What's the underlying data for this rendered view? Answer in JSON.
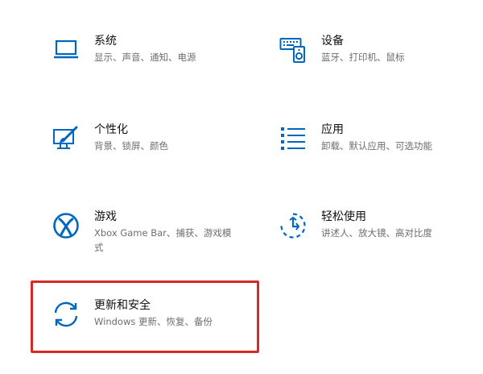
{
  "colors": {
    "accent": "#0067c0",
    "highlight": "#d62a27",
    "title": "#111111",
    "desc": "#6e6e6e"
  },
  "tiles": {
    "system": {
      "icon": "laptop-icon",
      "title": "系统",
      "desc": "显示、声音、通知、电源"
    },
    "devices": {
      "icon": "keyboard-speaker-icon",
      "title": "设备",
      "desc": "蓝牙、打印机、鼠标"
    },
    "personal": {
      "icon": "paint-brush-icon",
      "title": "个性化",
      "desc": "背景、锁屏、颜色"
    },
    "apps": {
      "icon": "app-list-icon",
      "title": "应用",
      "desc": "卸载、默认应用、可选功能"
    },
    "gaming": {
      "icon": "xbox-icon",
      "title": "游戏",
      "desc": "Xbox Game Bar、捕获、游戏模式"
    },
    "ease": {
      "icon": "ease-of-access-icon",
      "title": "轻松使用",
      "desc": "讲述人、放大镜、高对比度"
    },
    "update": {
      "icon": "sync-icon",
      "title": "更新和安全",
      "desc": "Windows 更新、恢复、备份"
    }
  }
}
